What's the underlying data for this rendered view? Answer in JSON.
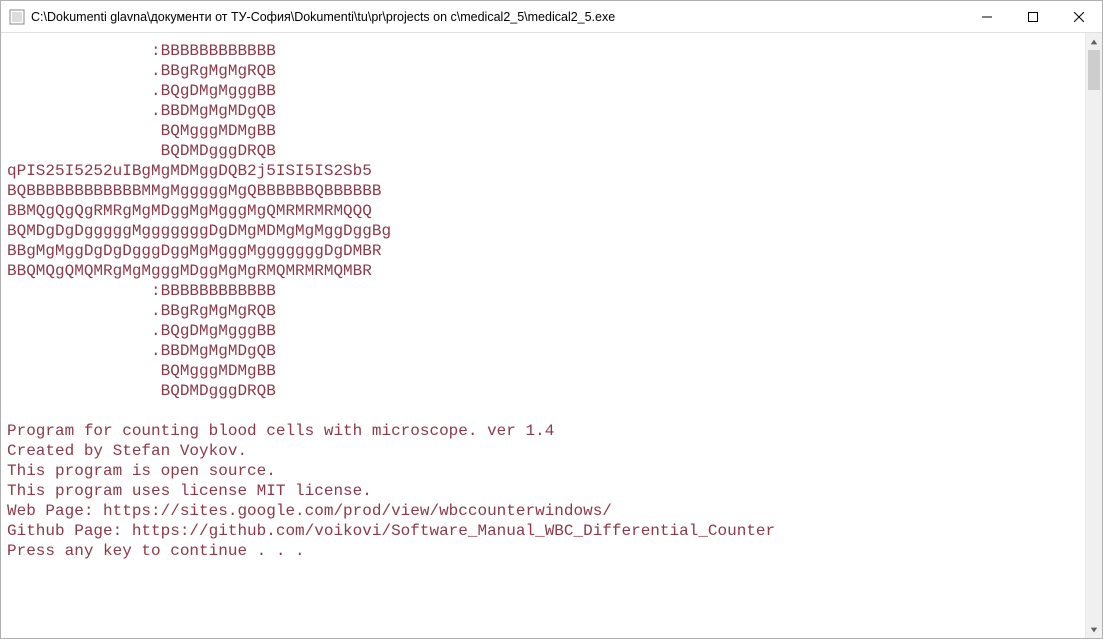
{
  "window": {
    "title": "C:\\Dokumenti glavna\\документи от ТУ-София\\Dokumenti\\tu\\pr\\projects on c\\medical2_5\\medical2_5.exe"
  },
  "console": {
    "lines": [
      "               :BBBBBBBBBBBB",
      "               .BBgRgMgMgRQB",
      "               .BQgDMgMgggBB",
      "               .BBDMgMgMDgQB",
      "                BQMgggMDMgBB",
      "                BQDMDgggDRQB",
      "qPIS25I5252uIBgMgMDMggDQB2j5ISI5IS2Sb5",
      "BQBBBBBBBBBBBBMMgMgggggMgQBBBBBBQBBBBBB",
      "BBMQgQgQgRMRgMgMDggMgMgggMgQMRMRMRMQQQ",
      "BQMDgDgDgggggMgggggggDgDMgMDMgMgMggDggBg",
      "BBgMgMggDgDgDgggDggMgMgggMgggggggDgDMBR",
      "BBQMQgQMQMRgMgMgggMDggMgMgRMQMRMRMQMBR",
      "               :BBBBBBBBBBBB",
      "               .BBgRgMgMgRQB",
      "               .BQgDMgMgggBB",
      "               .BBDMgMgMDgQB",
      "                BQMgggMDMgBB",
      "                BQDMDgggDRQB",
      "",
      "Program for counting blood cells with microscope. ver 1.4",
      "Created by Stefan Voykov.",
      "This program is open source.",
      "This program uses license MIT license.",
      "Web Page: https://sites.google.com/prod/view/wbccounterwindows/",
      "Github Page: https://github.com/voikovi/Software_Manual_WBC_Differential_Counter",
      "Press any key to continue . . ."
    ]
  },
  "colors": {
    "console_text": "#8b3a4a",
    "background": "#ffffff"
  }
}
